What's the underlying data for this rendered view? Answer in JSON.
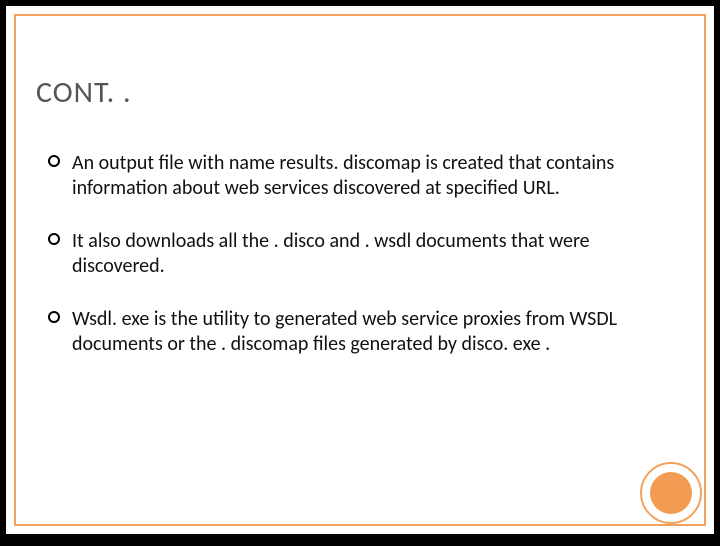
{
  "title": "CONT. .",
  "bullets": [
    "An output file with name results. discomap is created that contains information about web services discovered at specified URL.",
    "It also downloads all the . disco and . wsdl documents that were discovered.",
    "Wsdl. exe is the utility to generated  web service proxies from WSDL documents or the . discomap files generated by disco. exe ."
  ],
  "colors": {
    "accent": "#f4a15d"
  }
}
